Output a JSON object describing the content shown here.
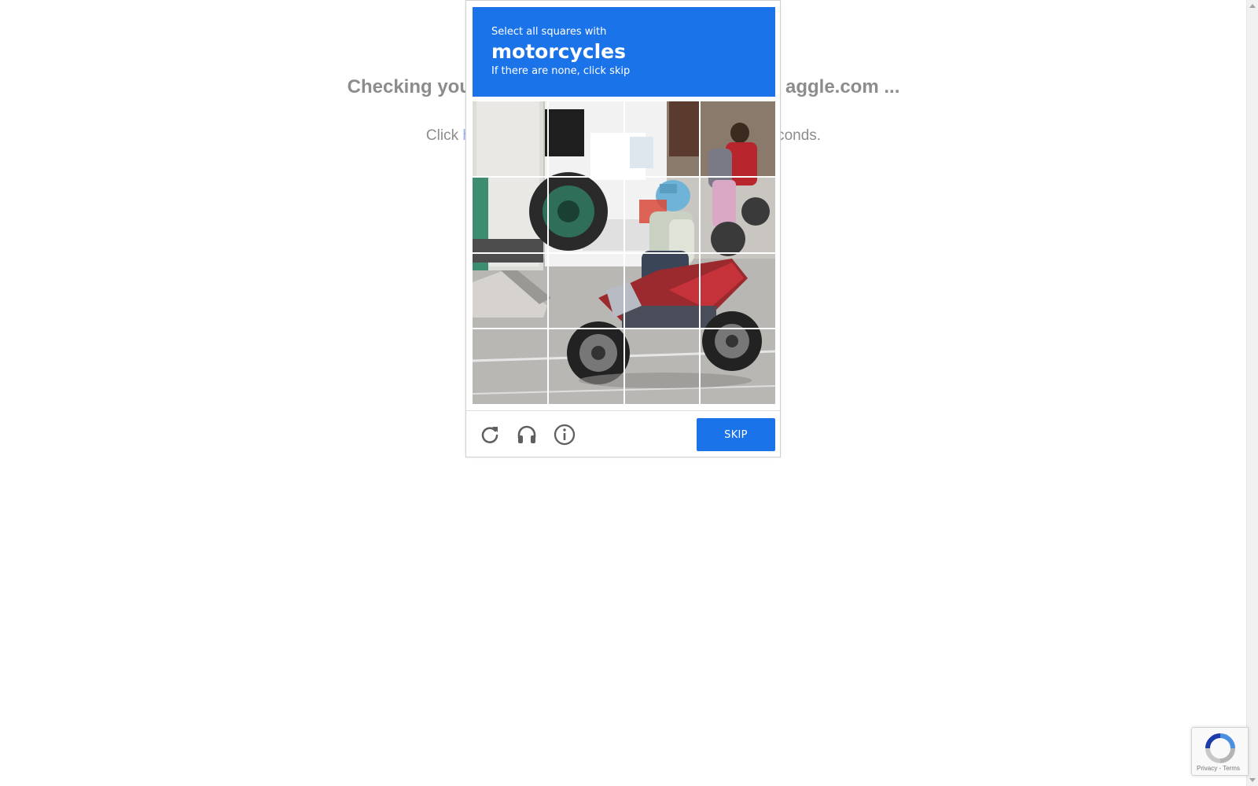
{
  "background": {
    "heading_left": "Checking you",
    "heading_right": "aggle.com ...",
    "line_left": "Click ",
    "line_link": "he",
    "line_right": "econds."
  },
  "challenge": {
    "instruction_pre": "Select all squares with",
    "target_object": "motorcycles",
    "instruction_post": "If there are none, click skip",
    "grid_rows": 4,
    "grid_cols": 4,
    "skip_label": "SKIP",
    "icons": [
      "reload-icon",
      "audio-headphones-icon",
      "info-icon"
    ]
  },
  "badge": {
    "links": "Privacy - Terms"
  },
  "colors": {
    "accent": "#1a73e8",
    "muted_text": "#8c8c8c"
  }
}
